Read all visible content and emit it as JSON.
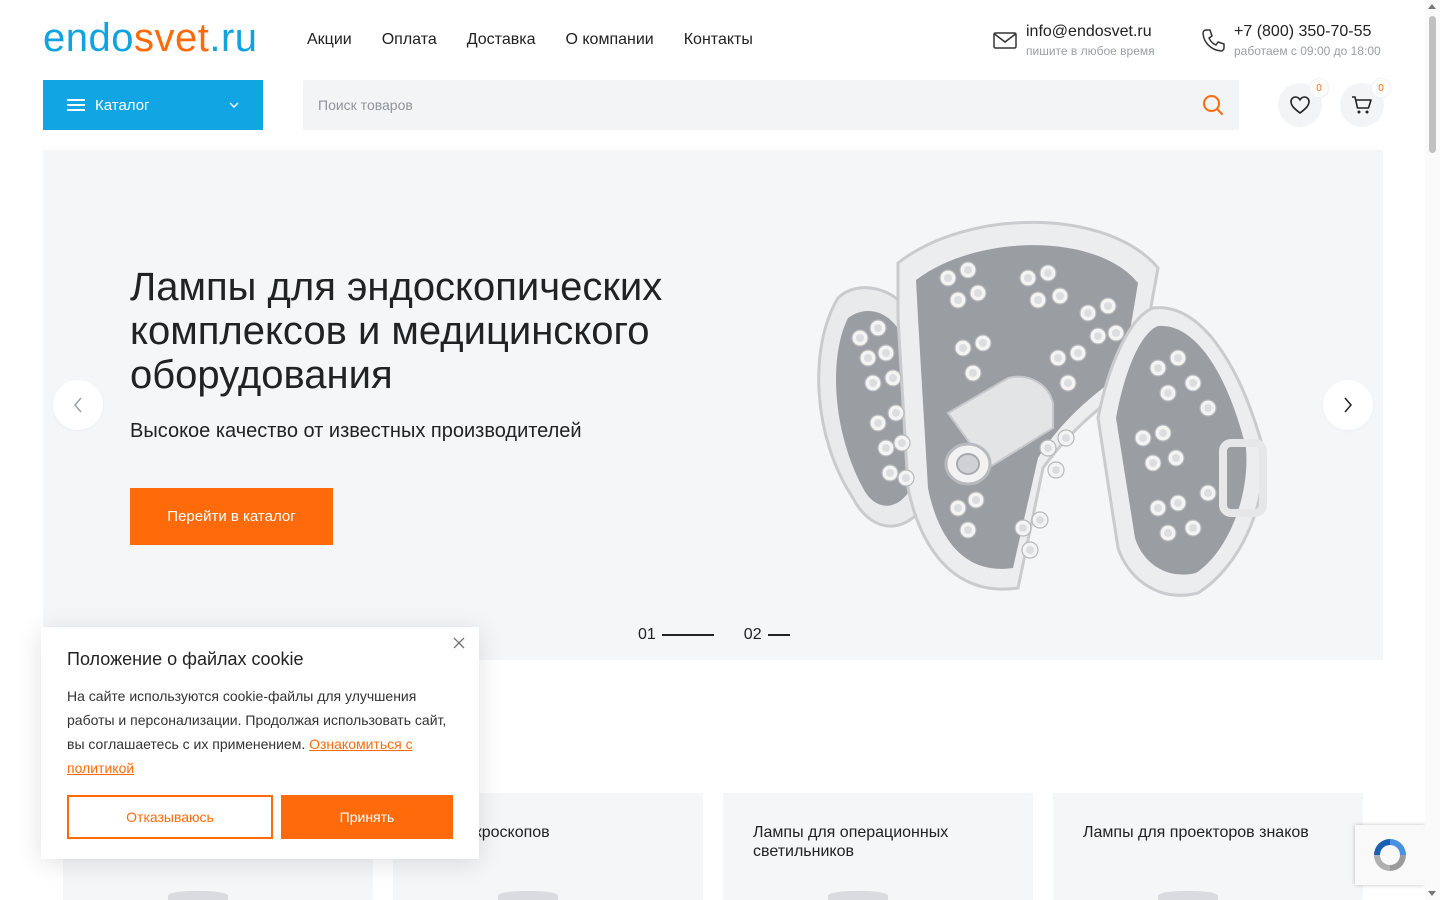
{
  "header": {
    "logo": {
      "part1": "endo",
      "part2": "svet",
      "part3": ".ru"
    },
    "nav": [
      "Акции",
      "Оплата",
      "Доставка",
      "О компании",
      "Контакты"
    ],
    "email": {
      "value": "info@endosvet.ru",
      "note": "пишите в любое время"
    },
    "phone": {
      "value": "+7 (800) 350-70-55",
      "note": "работаем с 09:00 до 18:00"
    }
  },
  "toolbar": {
    "catalog_label": "Каталог",
    "search_placeholder": "Поиск товаров",
    "favorites_count": "0",
    "cart_count": "0"
  },
  "hero": {
    "title": "Лампы для эндоскопических комплексов и медицинского оборудования",
    "subtitle": "Высокое качество от известных производителей",
    "cta_label": "Перейти в каталог",
    "slides": [
      "01",
      "02"
    ]
  },
  "categories": [
    {
      "title": ""
    },
    {
      "title": "для микроскопов"
    },
    {
      "title": "Лампы для операционных светильников"
    },
    {
      "title": "Лампы для проекторов знаков"
    }
  ],
  "cookie": {
    "title": "Положение о файлах cookie",
    "text": "На сайте используются cookie-файлы для улучшения работы и персонализации. Продолжая использовать сайт, вы соглашаетесь с их применением.",
    "link_label": "Ознакомиться с политикой",
    "decline_label": "Отказываюсь",
    "accept_label": "Принять"
  },
  "colors": {
    "brand_blue": "#12a5e4",
    "accent_orange": "#ff6b0a",
    "surface": "#f5f6f8"
  }
}
